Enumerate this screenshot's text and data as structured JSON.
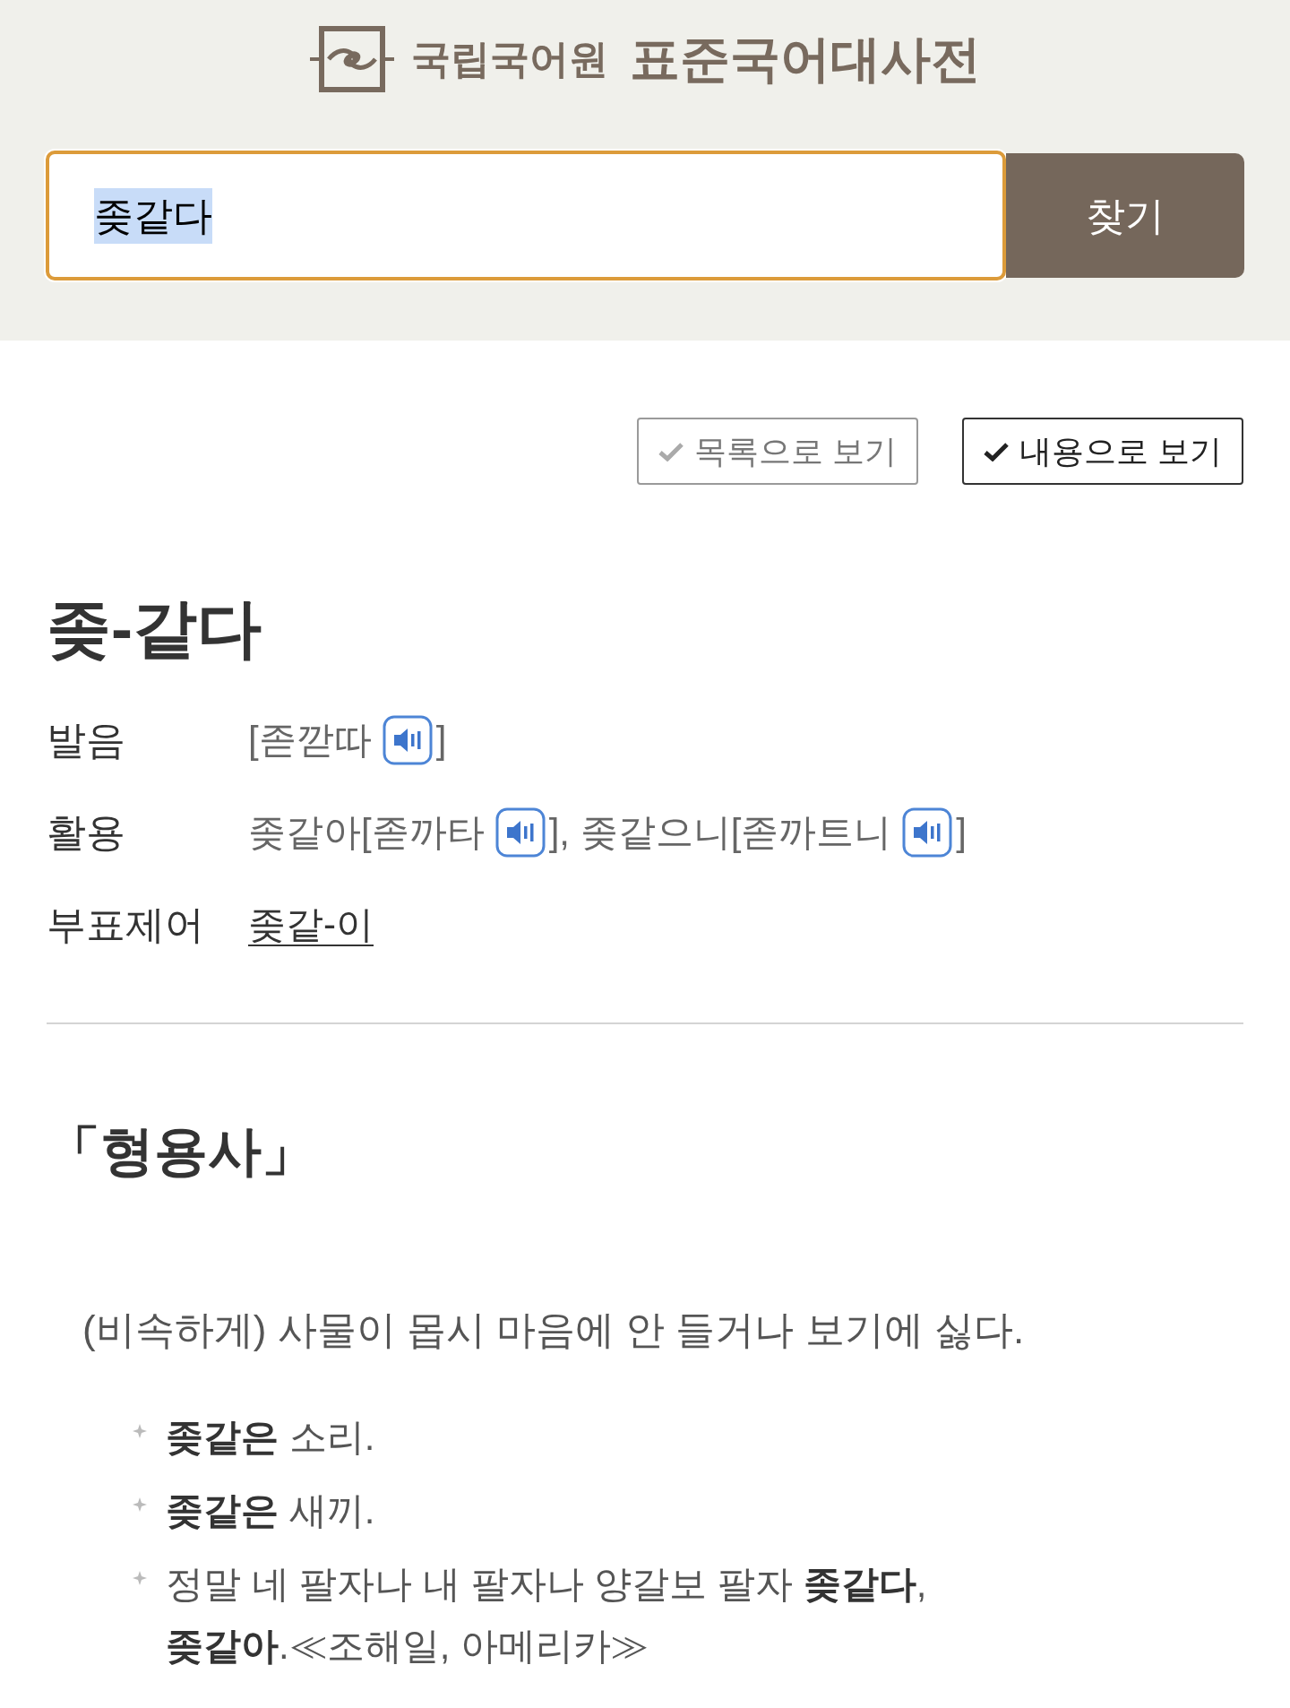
{
  "header": {
    "logo": {
      "org": "국립국어원",
      "title": "표준국어대사전"
    }
  },
  "search": {
    "value": "좆같다",
    "value_selected": true,
    "button": "찾기"
  },
  "view_options": [
    {
      "label": "목록으로 보기",
      "selected": false
    },
    {
      "label": "내용으로 보기",
      "selected": true
    }
  ],
  "entry": {
    "headword": "좆-같다",
    "info_rows": [
      {
        "label": "발음",
        "value": [
          {
            "kind": "text",
            "text": "[졷깓따"
          },
          {
            "kind": "audio"
          },
          {
            "kind": "text",
            "text": "]"
          }
        ]
      },
      {
        "label": "활용",
        "value": [
          {
            "kind": "text",
            "text": "좆같아[졷까타"
          },
          {
            "kind": "audio"
          },
          {
            "kind": "text",
            "text": "], 좆같으니[졷까트니"
          },
          {
            "kind": "audio"
          },
          {
            "kind": "text",
            "text": "]"
          }
        ]
      },
      {
        "label": "부표제어",
        "value": [
          {
            "kind": "link",
            "text": "좆같-이"
          }
        ]
      }
    ],
    "part_of_speech": "「형용사」",
    "senses": [
      {
        "definition": "(비속하게) 사물이 몹시 마음에 안 들거나 보기에 싫다.",
        "examples": [
          "**좆같은** 소리.",
          "**좆같은** 새끼.",
          "정말 네 팔자나 내 팔자나 양갈보 팔자 **좆같다**, **좆같아**.≪조해일, 아메리카≫"
        ]
      }
    ]
  }
}
